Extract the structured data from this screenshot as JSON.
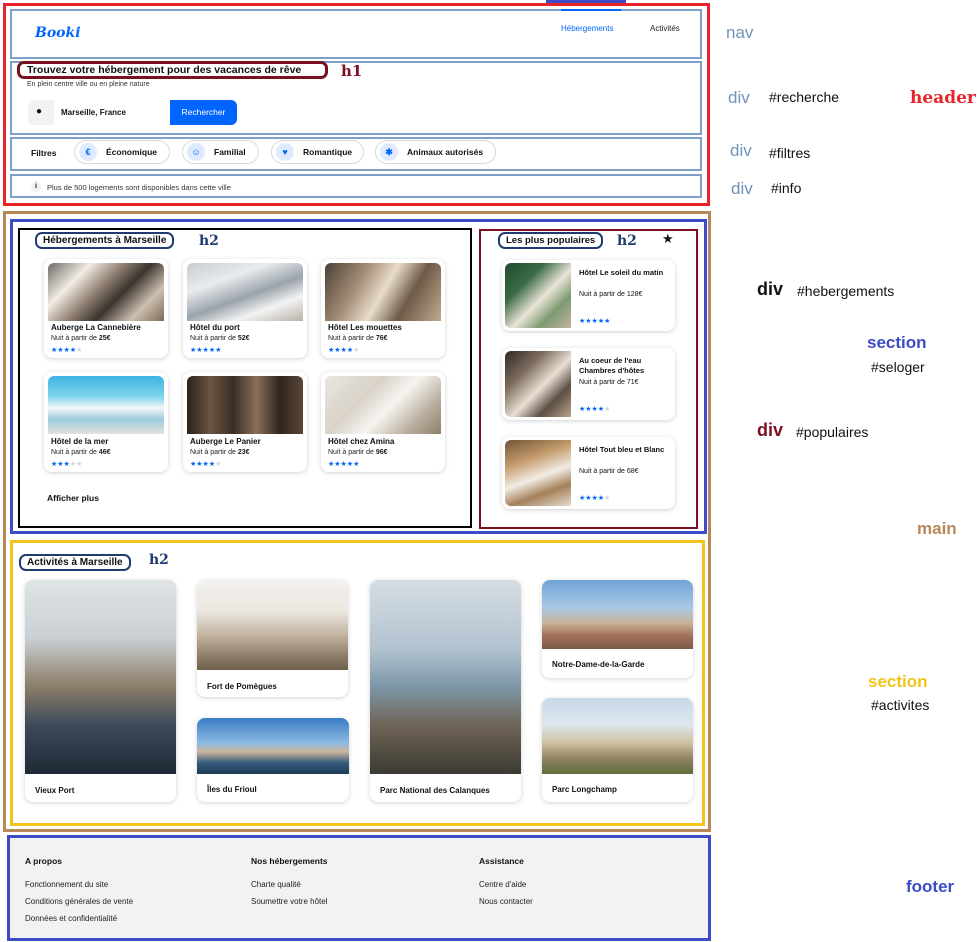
{
  "annotations": {
    "nav": "nav",
    "recherche_tag": "div",
    "recherche_id": "#recherche",
    "header": "header",
    "filtres_tag": "div",
    "filtres_id": "#filtres",
    "info_tag": "div",
    "info_id": "#info",
    "hebergements_tag": "div",
    "hebergements_id": "#hebergements",
    "seloger_tag": "section",
    "seloger_id": "#seloger",
    "populaires_tag": "div",
    "populaires_id": "#populaires",
    "main": "main",
    "activites_tag": "section",
    "activites_id": "#activites",
    "footer": "footer",
    "h1": "h1",
    "h2": "h2",
    "colors": {
      "header": "#e8232a",
      "nav": "#7fa0c8",
      "main": "#b8875a",
      "section": "#3d4bc7",
      "hebergements": "#000000",
      "populaires": "#7a1020",
      "activites": "#f2c31a",
      "footer": "#3d4bc7",
      "accent": "#0065fc"
    }
  },
  "nav": {
    "logo": "Booki",
    "links": [
      "Hébergements",
      "Activités"
    ]
  },
  "search": {
    "title": "Trouvez votre hébergement pour des vacances de rêve",
    "subtitle": "En plein centre ville ou en pleine nature",
    "location_value": "Marseille, France",
    "button": "Rechercher",
    "icon": "location-pin-icon"
  },
  "filters": {
    "label": "Filtres",
    "items": [
      {
        "label": "Économique",
        "icon": "money-icon"
      },
      {
        "label": "Familial",
        "icon": "child-icon"
      },
      {
        "label": "Romantique",
        "icon": "heart-icon"
      },
      {
        "label": "Animaux autorisés",
        "icon": "dog-icon"
      }
    ]
  },
  "info": {
    "text": "Plus de 500 logements sont disponibles dans cette ville",
    "icon": "info-icon"
  },
  "hebergements": {
    "title": "Hébergements à Marseille",
    "more": "Afficher plus",
    "items": [
      {
        "name": "Auberge La Cannebière",
        "price_prefix": "Nuit à partir de ",
        "price": "25€",
        "rating": 4
      },
      {
        "name": "Hôtel du port",
        "price_prefix": "Nuit à partir de ",
        "price": "52€",
        "rating": 5
      },
      {
        "name": "Hôtel Les mouettes",
        "price_prefix": "Nuit à partir de ",
        "price": "76€",
        "rating": 4
      },
      {
        "name": "Hôtel de la mer",
        "price_prefix": "Nuit à partir de ",
        "price": "46€",
        "rating": 3
      },
      {
        "name": "Auberge Le Panier",
        "price_prefix": "Nuit à partir de ",
        "price": "23€",
        "rating": 4
      },
      {
        "name": "Hôtel chez Amina",
        "price_prefix": "Nuit à partir de ",
        "price": "96€",
        "rating": 5
      }
    ]
  },
  "populaires": {
    "title": "Les plus populaires",
    "icon": "star-icon",
    "items": [
      {
        "name": "Hôtel Le soleil du matin",
        "price": "Nuit à partir de 128€",
        "rating": 5
      },
      {
        "name": "Au coeur de l'eau Chambres d'hôtes",
        "price": "Nuit à partir de 71€",
        "rating": 4
      },
      {
        "name": "Hôtel Tout bleu et Blanc",
        "price": "Nuit à partir de 68€",
        "rating": 4
      }
    ]
  },
  "activites": {
    "title": "Activités à Marseille",
    "items": [
      "Vieux Port",
      "Fort de Pomègues",
      "Îles du Frioul",
      "Parc National des Calanques",
      "Notre-Dame-de-la-Garde",
      "Parc Longchamp"
    ]
  },
  "footer": {
    "columns": [
      {
        "title": "A propos",
        "links": [
          "Fonctionnement du site",
          "Conditions générales de vente",
          "Données et confidentialité"
        ]
      },
      {
        "title": "Nos hébergements",
        "links": [
          "Charte qualité",
          "Soumettre votre hôtel"
        ]
      },
      {
        "title": "Assistance",
        "links": [
          "Centre d'aide",
          "Nous contacter"
        ]
      }
    ]
  }
}
